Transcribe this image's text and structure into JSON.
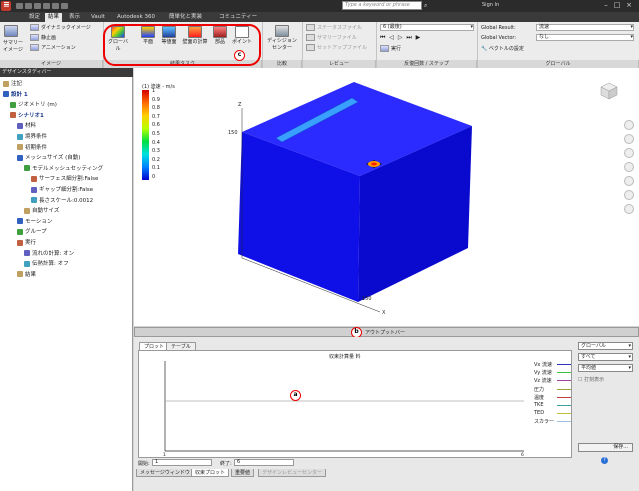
{
  "titlebar": {
    "search_placeholder": "Type a keyword or phrase",
    "signin": "Sign In"
  },
  "tabs": [
    "設定",
    "結果",
    "表示",
    "Vault",
    "Autodesk 360",
    "簡単化と実装",
    "コミュニティー"
  ],
  "ribbon": {
    "images_group": {
      "summary_label": "サマリー\nイメージ",
      "dynamic_image": "ダイナミックイメージ",
      "still_image": "静止画",
      "animation": "アニメーション",
      "group_label": "イメージ"
    },
    "result_tasks": {
      "buttons": [
        "グローバル",
        "平面",
        "等値面",
        "壁面の計算",
        "部品",
        "ポイント"
      ],
      "group_label": "結果タスク"
    },
    "compare": {
      "button": "ディシジョン\nセンター",
      "group_label": "比較"
    },
    "review": {
      "items": [
        "ステータスファイル",
        "サマリーファイル",
        "セットアップファイル"
      ],
      "group_label": "レビュー"
    },
    "transient": {
      "step_value": "6 (最後)",
      "run_label": "実行",
      "group_label": "反復回数 / ステップ"
    },
    "global": {
      "result_label": "Global Result:",
      "result_value": "流速",
      "vector_label": "Global Vector:",
      "vector_value": "なし",
      "vector_settings": "ベクトルの設定",
      "group_label": "グローバル"
    }
  },
  "panel": {
    "header": "デザインスタディバー",
    "items": [
      {
        "label": "注記",
        "level": 0
      },
      {
        "label": "設計 1",
        "level": 0,
        "bold": true
      },
      {
        "label": "ジオメトリ (m)",
        "level": 1
      },
      {
        "label": "シナリオ1",
        "level": 1,
        "bold": true
      },
      {
        "label": "材料",
        "level": 2
      },
      {
        "label": "境界条件",
        "level": 2
      },
      {
        "label": "初期条件",
        "level": 2
      },
      {
        "label": "メッシュサイズ (自動)",
        "level": 2
      },
      {
        "label": "モデルメッシュセッティング",
        "level": 3
      },
      {
        "label": "サーフェス細分割:False",
        "level": 4
      },
      {
        "label": "ギャップ細分割:False",
        "level": 4
      },
      {
        "label": "長さスケール:0.0012",
        "level": 4
      },
      {
        "label": "自動サイズ",
        "level": 3
      },
      {
        "label": "モーション",
        "level": 2
      },
      {
        "label": "グループ",
        "level": 2
      },
      {
        "label": "実行",
        "level": 2
      },
      {
        "label": "流れの計算: オン",
        "level": 3
      },
      {
        "label": "伝熱計算: オフ",
        "level": 3
      },
      {
        "label": "結果",
        "level": 2
      }
    ]
  },
  "viewport": {
    "legend_title": "(1) 流速 - m/s",
    "legend_ticks": [
      "1",
      "0.9",
      "0.8",
      "0.7",
      "0.6",
      "0.5",
      "0.4",
      "0.3",
      "0.2",
      "0.1",
      "0"
    ],
    "axis_z": "Z",
    "axis_x": "X",
    "tick_top": "150",
    "tick_bottom": "150"
  },
  "output_bar": {
    "label": "アウトプットバー"
  },
  "plot": {
    "tabs": [
      "プロット",
      "テーブル"
    ],
    "title": "収束計算量 料",
    "legend": [
      {
        "name": "Vx 流速",
        "color": "#3030c0"
      },
      {
        "name": "Vy 流速",
        "color": "#40c040"
      },
      {
        "name": "Vz 流速",
        "color": "#a040a0"
      },
      {
        "name": "圧力",
        "color": "#a0a040"
      },
      {
        "name": "温度",
        "color": "#c04040"
      },
      {
        "name": "TKE",
        "color": "#40a0a0"
      },
      {
        "name": "TED",
        "color": "#c0c040"
      },
      {
        "name": "スカラー",
        "color": "#a0c0e0"
      }
    ],
    "x_start": "1",
    "x_end": "6"
  },
  "side_controls": {
    "combo1": "グローバル",
    "combo2": "すべて",
    "combo3": "平均値",
    "checkbox_label": "打刻表示",
    "save_button": "保存..."
  },
  "range": {
    "start_label": "開始:",
    "start_value": "1",
    "end_label": "終了:",
    "end_value": "6"
  },
  "bottom_tabs": [
    "メッセージウィンドウ",
    "収束プロット",
    "重要値",
    "デザインレビューセンター"
  ],
  "badges": {
    "a": "a",
    "b": "b",
    "c": "c"
  },
  "colors": {
    "accent": "#e00000",
    "model": "#1a1aff"
  }
}
